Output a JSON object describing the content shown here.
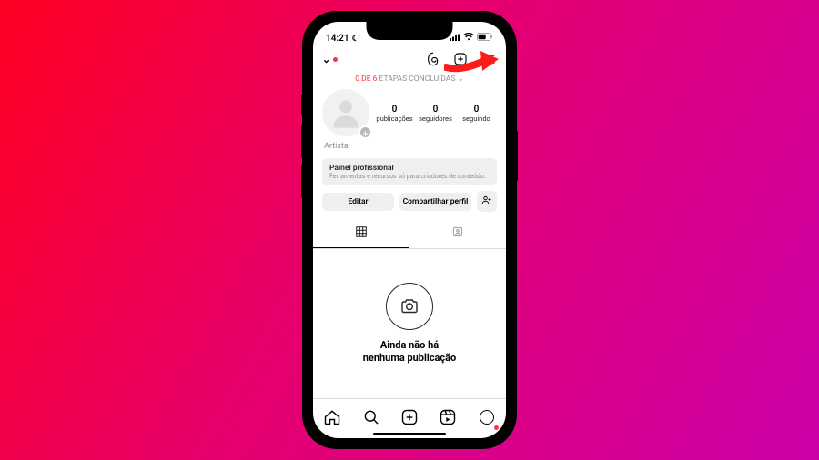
{
  "status": {
    "time": "14:21"
  },
  "header": {
    "chevron": "⌄"
  },
  "steps": {
    "red": "0 DE 6",
    "rest": " ETAPAS CONCLUÍDAS",
    "chevron": "⌄"
  },
  "stats": {
    "posts": {
      "num": "0",
      "label": "publicações"
    },
    "followers": {
      "num": "0",
      "label": "seguidores"
    },
    "following": {
      "num": "0",
      "label": "seguindo"
    }
  },
  "bio": {
    "category": "Artista"
  },
  "pro_panel": {
    "title": "Painel profissional",
    "subtitle": "Ferramentas e recursos só para criadores de conteúdo."
  },
  "actions": {
    "edit": "Editar",
    "share": "Compartilhar perfil"
  },
  "empty": {
    "line1": "Ainda não há",
    "line2": "nenhuma publicação"
  }
}
